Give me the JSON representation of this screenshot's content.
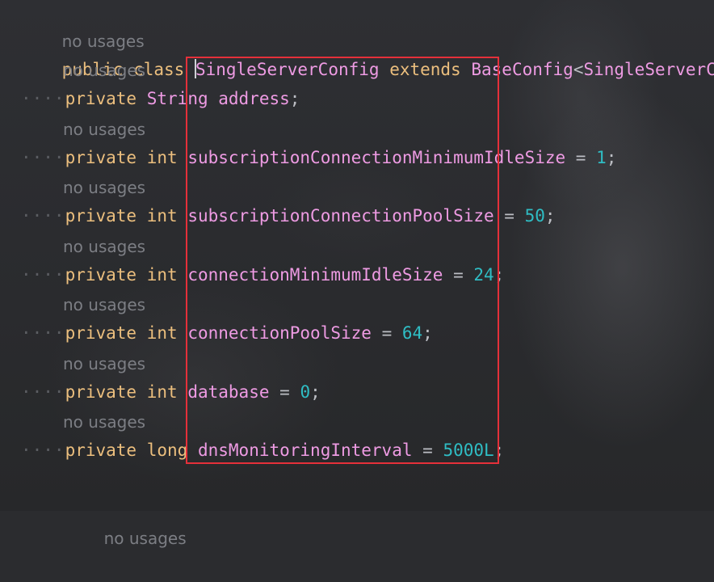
{
  "colors": {
    "background": "#2b2c2f",
    "keyword": "#ecbf7e",
    "type_or_field": "#ee9be3",
    "number": "#2fbdc4",
    "hint": "#7c7e84",
    "highlight_box": "#e5303a"
  },
  "code": {
    "class_hint": "no usages",
    "class_line": {
      "modifier": "public",
      "keyword": "class",
      "name": "SingleServerConfig",
      "extends_kw": "extends",
      "base": "BaseConfig",
      "generic_open": "<",
      "generic_arg": "SingleServerCon"
    },
    "indent_dots": "····",
    "fields": [
      {
        "hint": "no usages",
        "modifier": "private",
        "type": "String",
        "name": "address",
        "eq": "",
        "value": "",
        "end": ";"
      },
      {
        "hint": "no usages",
        "modifier": "private",
        "type": "int",
        "name": "subscriptionConnectionMinimumIdleSize",
        "eq": " = ",
        "value": "1",
        "end": ";"
      },
      {
        "hint": "no usages",
        "modifier": "private",
        "type": "int",
        "name": "subscriptionConnectionPoolSize",
        "eq": " = ",
        "value": "50",
        "end": ";"
      },
      {
        "hint": "no usages",
        "modifier": "private",
        "type": "int",
        "name": "connectionMinimumIdleSize",
        "eq": " = ",
        "value": "24",
        "end": ";"
      },
      {
        "hint": "no usages",
        "modifier": "private",
        "type": "int",
        "name": "connectionPoolSize",
        "eq": " = ",
        "value": "64",
        "end": ";"
      },
      {
        "hint": "no usages",
        "modifier": "private",
        "type": "int",
        "name": "database",
        "eq": " = ",
        "value": "0",
        "end": ";"
      },
      {
        "hint": "no usages",
        "modifier": "private",
        "type": "long",
        "name": "dnsMonitoringInterval",
        "eq": " = ",
        "value": "5000L",
        "end": ";"
      }
    ],
    "trailing_hint": "no usages"
  }
}
